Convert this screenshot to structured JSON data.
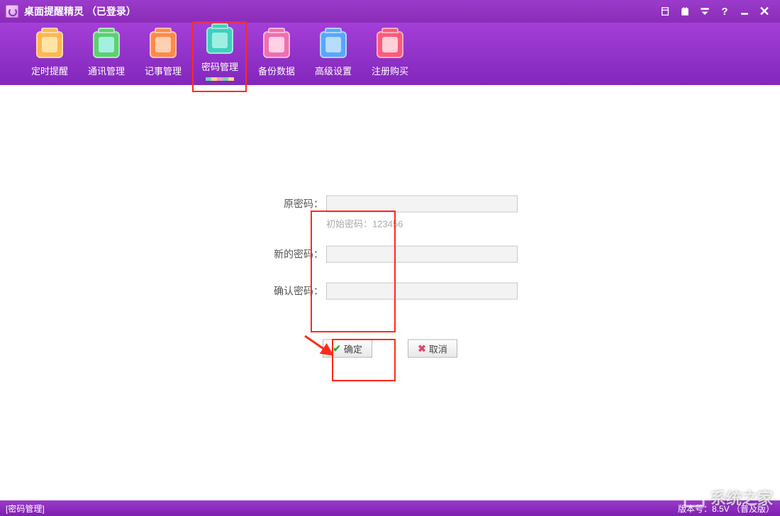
{
  "title": "桌面提醒精灵 （已登录）",
  "toolbar": [
    {
      "label": "定时提醒",
      "icon": "timer-icon",
      "bg": "#ffb652",
      "inner": "#ffe4a6"
    },
    {
      "label": "通讯管理",
      "icon": "contacts-icon",
      "bg": "#5ecf72",
      "inner": "#a4f0e0"
    },
    {
      "label": "记事管理",
      "icon": "notes-icon",
      "bg": "#ff8a4a",
      "inner": "#ffd0b0"
    },
    {
      "label": "密码管理",
      "icon": "password-icon",
      "bg": "#3fd0bd",
      "inner": "#a0eee2"
    },
    {
      "label": "备份数据",
      "icon": "backup-icon",
      "bg": "#f06fb0",
      "inner": "#ffd0e6"
    },
    {
      "label": "高级设置",
      "icon": "settings-icon",
      "bg": "#5aa6ff",
      "inner": "#b6dcff"
    },
    {
      "label": "注册购买",
      "icon": "purchase-icon",
      "bg": "#ff5a7a",
      "inner": "#ffd0d8"
    }
  ],
  "active_toolbar_index": 3,
  "form": {
    "old_password_label": "原密码：",
    "old_password_value": "",
    "hint": "初始密码：123456",
    "new_password_label": "新的密码：",
    "new_password_value": "",
    "confirm_password_label": "确认密码：",
    "confirm_password_value": "",
    "ok_label": "确定",
    "cancel_label": "取消"
  },
  "statusbar": {
    "left": "[密码管理]",
    "right": "版本号：8.5V （普及版）"
  },
  "watermark": "系统之家"
}
